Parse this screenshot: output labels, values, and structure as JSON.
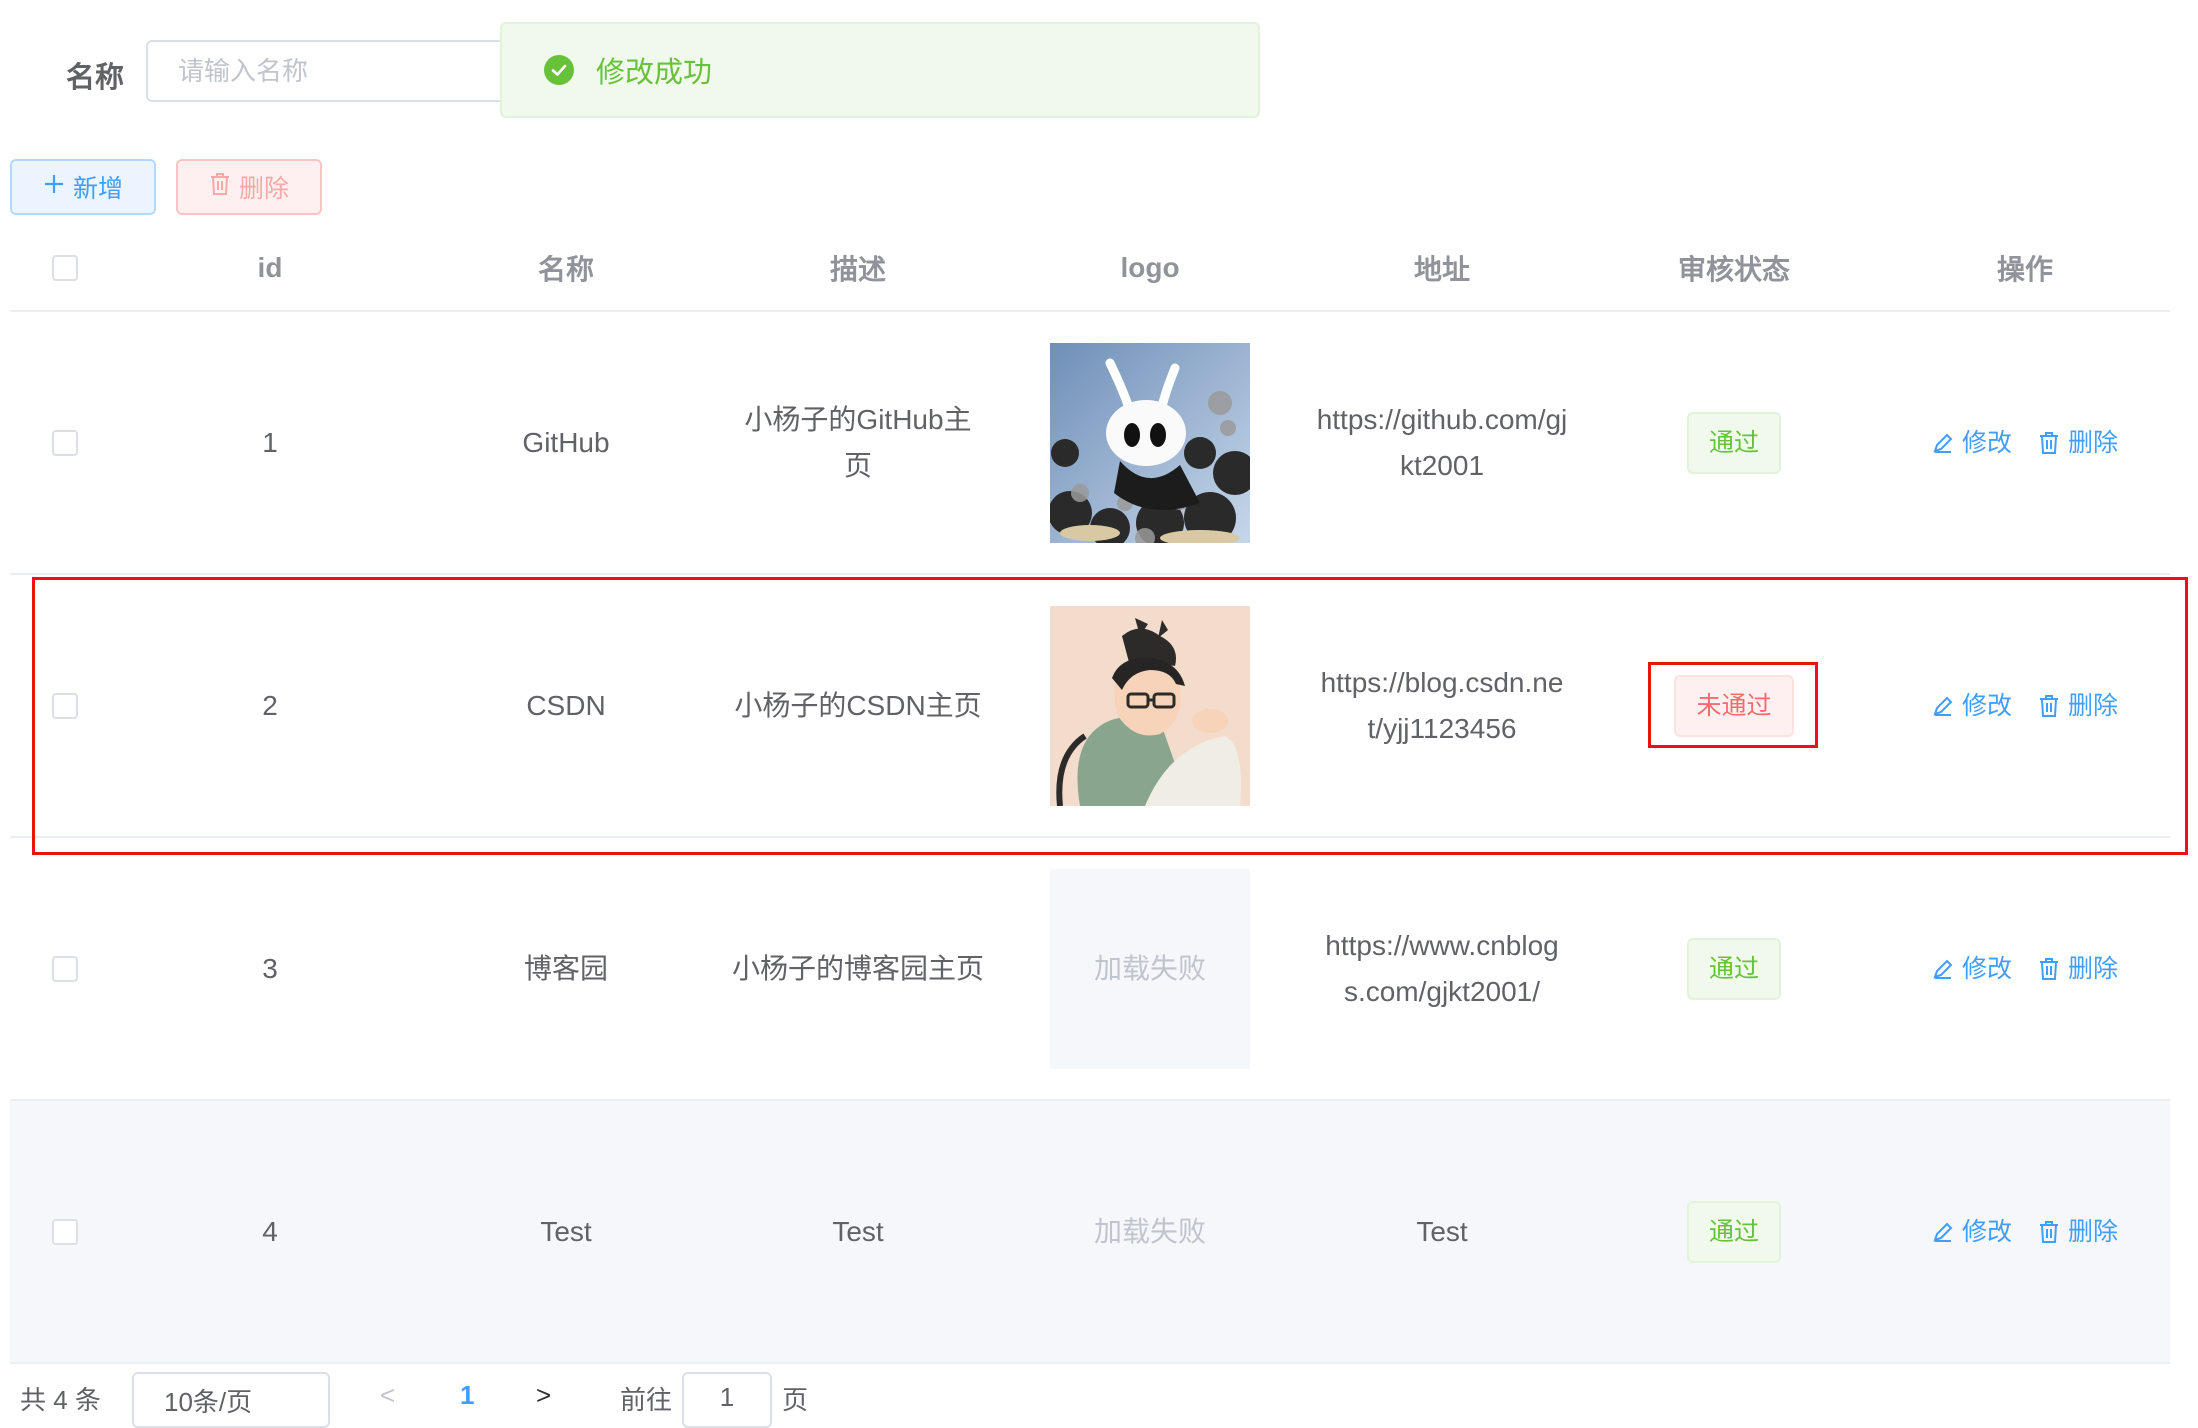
{
  "search": {
    "label": "名称",
    "placeholder": "请输入名称"
  },
  "toast": {
    "message": "修改成功"
  },
  "toolbar": {
    "add_label": "新增",
    "delete_label": "删除"
  },
  "table": {
    "headers": {
      "id": "id",
      "name": "名称",
      "desc": "描述",
      "logo": "logo",
      "url": "地址",
      "status": "审核状态",
      "ops": "操作"
    },
    "rows": [
      {
        "id": "1",
        "name": "GitHub",
        "desc_line1": "小杨子的GitHub主",
        "desc_line2": "页",
        "logo": "hollow-knight-image",
        "url_line1": "https://github.com/gj",
        "url_line2": "kt2001",
        "status": "通过",
        "edit": "修改",
        "delete": "删除"
      },
      {
        "id": "2",
        "name": "CSDN",
        "desc_line1": "小杨子的CSDN主页",
        "desc_line2": "",
        "logo": "anime-boy-cat-image",
        "url_line1": "https://blog.csdn.ne",
        "url_line2": "t/yjj1123456",
        "status": "未通过",
        "edit": "修改",
        "delete": "删除"
      },
      {
        "id": "3",
        "name": "博客园",
        "desc_line1": "小杨子的博客园主页",
        "desc_line2": "",
        "logo_fail": "加载失败",
        "url_line1": "https://www.cnblog",
        "url_line2": "s.com/gjkt2001/",
        "status": "通过",
        "edit": "修改",
        "delete": "删除"
      },
      {
        "id": "4",
        "name": "Test",
        "desc_line1": "Test",
        "desc_line2": "",
        "logo_fail": "加载失败",
        "url_line1": "Test",
        "url_line2": "",
        "status": "通过",
        "edit": "修改",
        "delete": "删除"
      }
    ]
  },
  "pagination": {
    "total": "共 4 条",
    "page_size": "10条/页",
    "prev": "<",
    "current": "1",
    "next": ">",
    "goto": "前往",
    "jump": "1",
    "page_unit": "页"
  },
  "colors": {
    "primary": "#409eff",
    "success": "#67c23a",
    "danger": "#f56c6c",
    "annotation": "#ee1111"
  }
}
